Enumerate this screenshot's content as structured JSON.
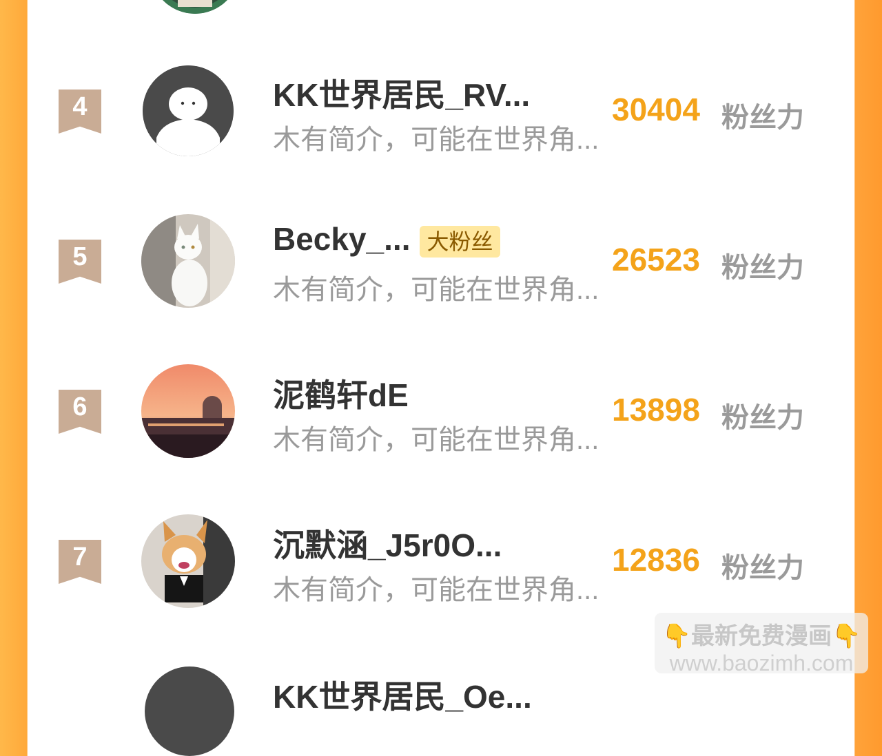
{
  "entries": [
    {
      "rank": "4",
      "name": "KK世界居民_RV...",
      "intro": "木有简介，可能在世界角...",
      "score": "30404",
      "score_label": "粉丝力"
    },
    {
      "rank": "5",
      "name": "Becky_...",
      "tag": "大粉丝",
      "intro": "木有简介，可能在世界角...",
      "score": "26523",
      "score_label": "粉丝力"
    },
    {
      "rank": "6",
      "name": "泥鹤轩dE",
      "intro": "木有简介，可能在世界角...",
      "score": "13898",
      "score_label": "粉丝力"
    },
    {
      "rank": "7",
      "name": "沉默涵_J5r0O...",
      "intro": "木有简介，可能在世界角...",
      "score": "12836",
      "score_label": "粉丝力"
    }
  ],
  "next_entry_partial": {
    "name": "KK世界居民_Oe..."
  },
  "watermark": {
    "line1": "👇最新免费漫画👇",
    "line2": "www.baozimh.com"
  },
  "colors": {
    "accent": "#f4a31a",
    "badge": "#c9ac95",
    "side": "#ffa93a"
  }
}
